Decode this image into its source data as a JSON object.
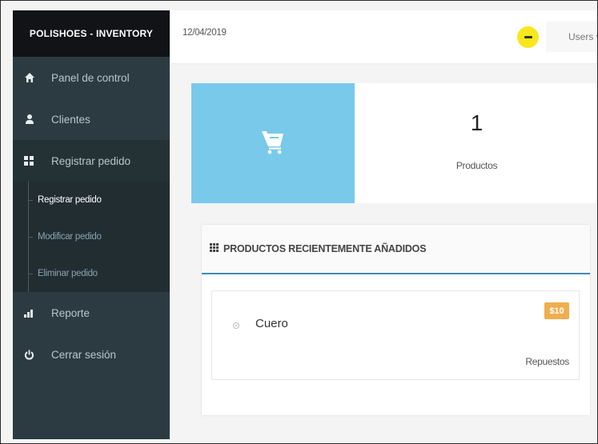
{
  "app": {
    "brand": "POLISHOES - INVENTORY"
  },
  "header": {
    "date": "12/04/2019",
    "user_menu_label": "Users ▾"
  },
  "sidebar": {
    "items": [
      {
        "label": "Panel de control",
        "icon": "home-icon"
      },
      {
        "label": "Clientes",
        "icon": "user-icon"
      },
      {
        "label": "Registrar pedido",
        "icon": "grid-icon",
        "expanded": true
      },
      {
        "label": "Reporte",
        "icon": "bar-chart-icon"
      },
      {
        "label": "Cerrar sesión",
        "icon": "power-icon"
      }
    ],
    "submenu": [
      {
        "label": "Registrar pedido",
        "active": true
      },
      {
        "label": "Modificar pedido"
      },
      {
        "label": "Eliminar pedido"
      }
    ]
  },
  "stat": {
    "value": "1",
    "label": "Productos",
    "icon": "shopping-cart-icon",
    "color": "#79c9ea"
  },
  "panel": {
    "title": "PRODUCTOS RECIENTEMENTE AÑADIDOS",
    "accent_color": "#3c8dbc",
    "products": [
      {
        "name": "Cuero",
        "price": "$10",
        "category": "Repuestos",
        "price_color": "#f0ad4e"
      }
    ]
  }
}
